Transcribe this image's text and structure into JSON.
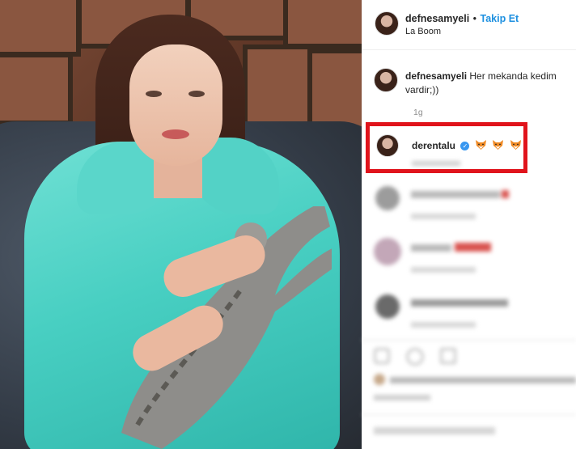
{
  "post": {
    "author": "defnesamyeli",
    "separator": "•",
    "follow_label": "Takip Et",
    "location": "La Boom"
  },
  "caption": {
    "author": "defnesamyeli",
    "text": "Her mekanda kedim vardir;))",
    "time": "1g"
  },
  "highlighted_comment": {
    "author": "derentalu",
    "verified_icon": "verified-badge-icon",
    "emojis": [
      "fox-face-icon",
      "fox-face-icon",
      "fox-face-icon"
    ]
  },
  "colors": {
    "follow_blue": "#1e90e0",
    "highlight_red": "#e0141c",
    "hoodie": "#48cfc2"
  }
}
